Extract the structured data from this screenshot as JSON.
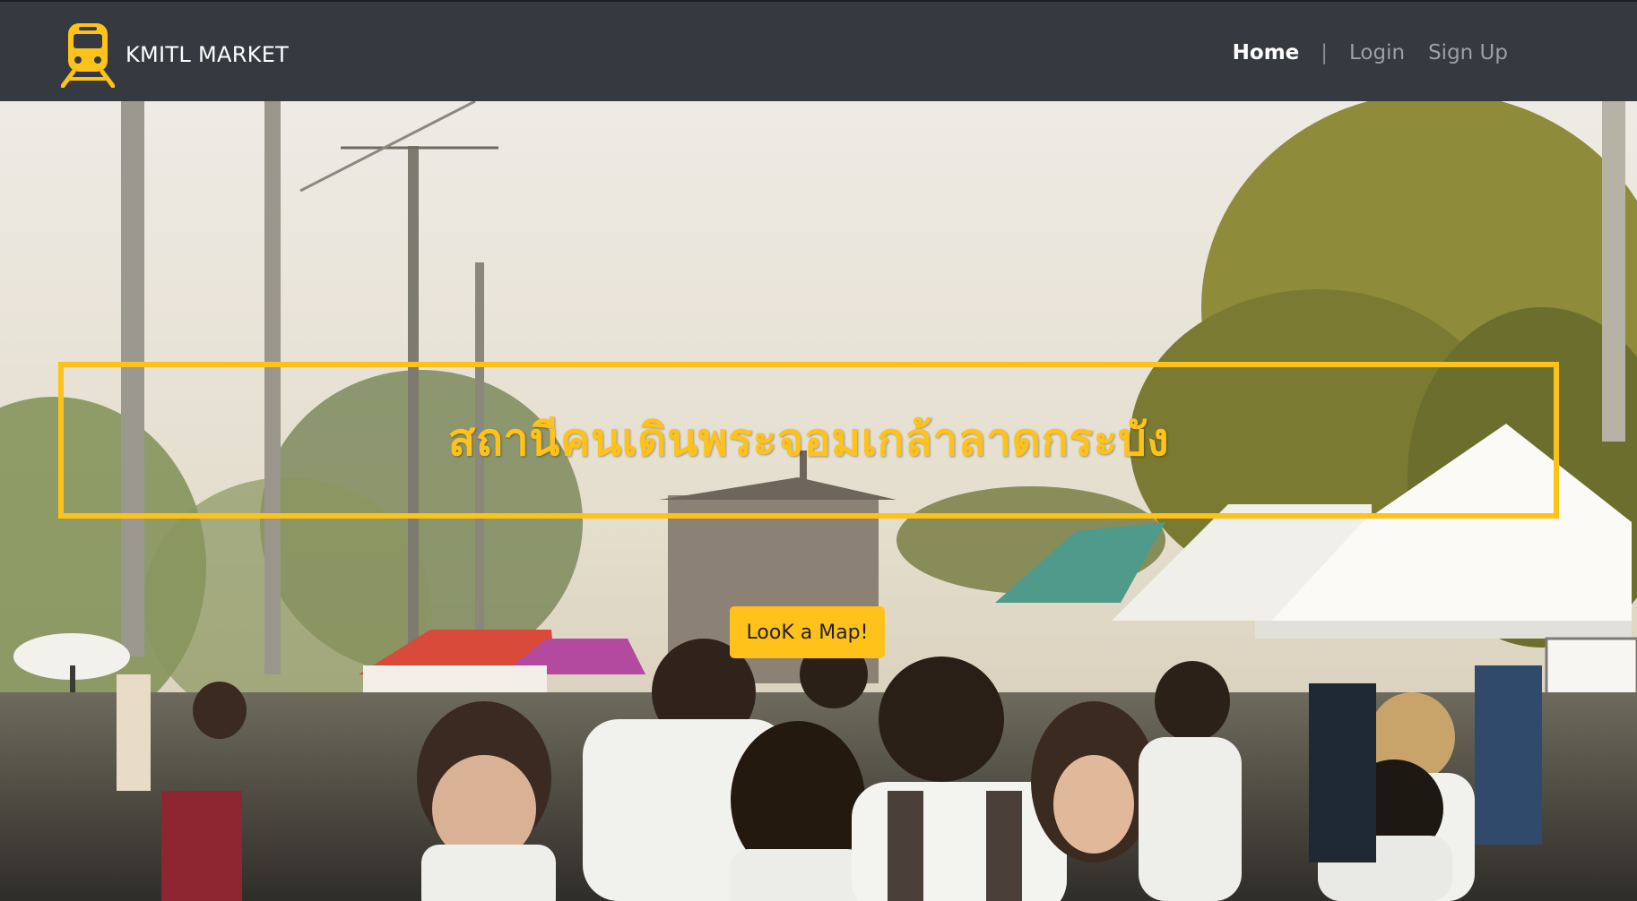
{
  "brand": {
    "name": "KMITL MARKET",
    "icon": "train-icon",
    "icon_color": "#ffc21a"
  },
  "nav": {
    "home": "Home",
    "separator": "|",
    "login": "Login",
    "signup": "Sign Up"
  },
  "hero": {
    "title": "สถานีคนเดินพระจอมเกล้าลาดกระบัง",
    "button_label": "LooK a Map!",
    "background": "outdoor-market-photo"
  },
  "colors": {
    "navbar": "#343a40",
    "accent": "#ffc21a",
    "text_light": "#ffffff",
    "text_muted": "#9aa0a6"
  }
}
